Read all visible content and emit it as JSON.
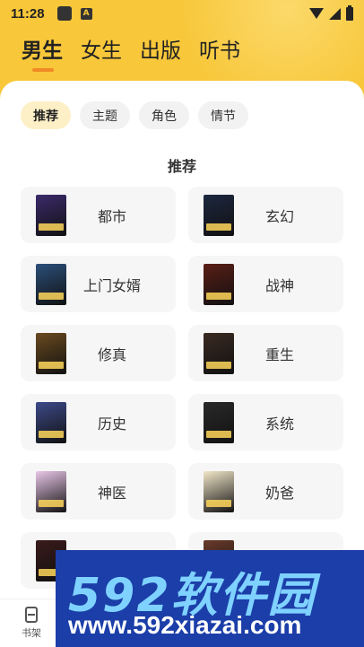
{
  "status_bar": {
    "time": "11:28",
    "notif_letter": "A"
  },
  "top_tabs": [
    {
      "label": "男生",
      "active": true
    },
    {
      "label": "女生",
      "active": false
    },
    {
      "label": "出版",
      "active": false
    },
    {
      "label": "听书",
      "active": false
    }
  ],
  "filter_chips": [
    {
      "label": "推荐",
      "active": true
    },
    {
      "label": "主题",
      "active": false
    },
    {
      "label": "角色",
      "active": false
    },
    {
      "label": "情节",
      "active": false
    }
  ],
  "section_title": "推荐",
  "categories": [
    {
      "label": "都市",
      "cover_color": "#3b2a6b"
    },
    {
      "label": "玄幻",
      "cover_color": "#1c2740"
    },
    {
      "label": "上门女婿",
      "cover_color": "#2b4f7a"
    },
    {
      "label": "战神",
      "cover_color": "#5a1e16"
    },
    {
      "label": "修真",
      "cover_color": "#6a4a1f"
    },
    {
      "label": "重生",
      "cover_color": "#3a2a22"
    },
    {
      "label": "历史",
      "cover_color": "#3d4a8a"
    },
    {
      "label": "系统",
      "cover_color": "#2a2a2a"
    },
    {
      "label": "神医",
      "cover_color": "#e9c7e8"
    },
    {
      "label": "奶爸",
      "cover_color": "#f2e7c9"
    },
    {
      "label": "",
      "cover_color": "#3a1a1a"
    },
    {
      "label": "",
      "cover_color": "#6a3a2a"
    }
  ],
  "bottom_nav": {
    "shelf_label": "书架"
  },
  "watermark": {
    "brand": "592软件园",
    "url": "www.592xiazai.com"
  }
}
